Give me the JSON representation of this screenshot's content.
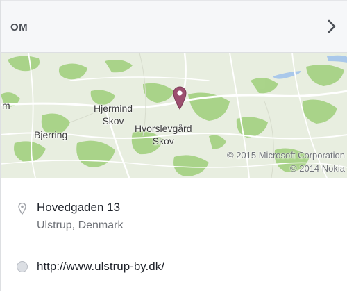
{
  "header": {
    "title": "OM"
  },
  "map": {
    "places": {
      "m": "m",
      "bjerring": "Bjerring",
      "hjermind": "Hjermind\nSkov",
      "hvorslev": "Hvorslevgård\nSkov"
    },
    "copyright": {
      "line1": "© 2015 Microsoft Corporation",
      "line2": "© 2014 Nokia"
    },
    "colors": {
      "land": "#e8eee0",
      "forest": "#9fcf7a",
      "water": "#a9c8ea",
      "road": "#ffffff",
      "pin": "#9c4f6f"
    }
  },
  "address": {
    "street": "Hovedgaden 13",
    "city": "Ulstrup, Denmark"
  },
  "website": {
    "url": "http://www.ulstrup-by.dk/"
  },
  "icons": {
    "chevron": "chevron-right-icon",
    "pin": "map-pin-icon",
    "location": "location-icon",
    "globe": "globe-icon"
  }
}
